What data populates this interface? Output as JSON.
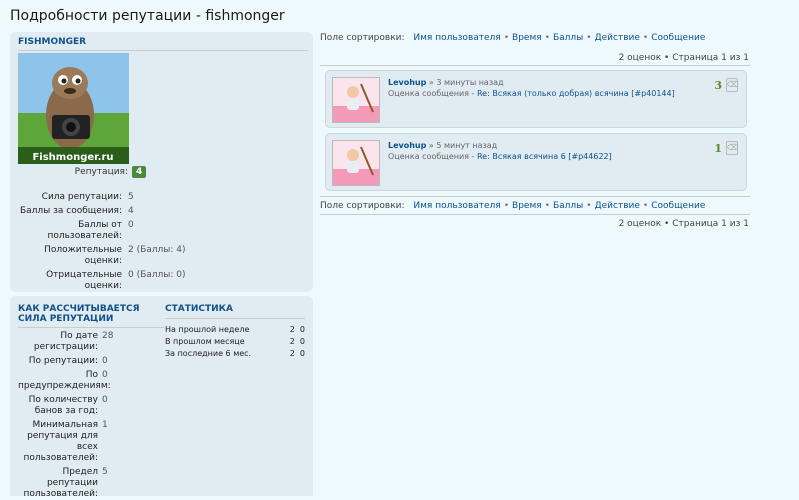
{
  "page": {
    "title": "Подробности репутации - fishmonger"
  },
  "profile": {
    "username": "FISHMONGER",
    "avatar_caption": "Fishmonger.ru",
    "reputation_label": "Репутация:",
    "reputation_value": "4",
    "stats": [
      {
        "label": "Сила репутации:",
        "value": "5"
      },
      {
        "label": "Баллы за сообщения:",
        "value": "4"
      },
      {
        "label": "Баллы от пользователей:",
        "value": "0"
      },
      {
        "label": "Положительные оценки:",
        "value": "2 (Баллы: 4)"
      },
      {
        "label": "Отрицательные оценки:",
        "value": "0 (Баллы: 0)"
      }
    ]
  },
  "calc": {
    "heading": "КАК РАССЧИТЫВАЕТСЯ СИЛА РЕПУТАЦИИ",
    "rows": [
      {
        "label": "По дате регистрации:",
        "value": "28"
      },
      {
        "label": "По репутации:",
        "value": "0"
      },
      {
        "label": "По предупреждениям:",
        "value": "0"
      },
      {
        "label": "По количеству банов за год:",
        "value": "0"
      },
      {
        "label": "Минимальная репутация для всех пользователей:",
        "value": "1"
      },
      {
        "label": "Предел репутации пользователей:",
        "value": "5"
      }
    ]
  },
  "statistics": {
    "heading": "СТАТИСТИКА",
    "rows": [
      {
        "label": "На прошлой неделе",
        "a": "2",
        "b": "0"
      },
      {
        "label": "В прошлом месяце",
        "a": "2",
        "b": "0"
      },
      {
        "label": "За последние 6 мес.",
        "a": "2",
        "b": "0"
      }
    ]
  },
  "sort": {
    "label": "Поле сортировки:",
    "options": [
      "Имя пользователя",
      "Время",
      "Баллы",
      "Действие",
      "Сообщение"
    ],
    "separator": "•"
  },
  "pagination": {
    "text": "2 оценок • Страница 1 из 1"
  },
  "posts": [
    {
      "user": "Levohup",
      "time": "» 3 минуты назад",
      "prefix": "Оценка сообщения - ",
      "topic": "Re: Всякая (только добрая) всячина",
      "ref": "[#p40144]",
      "score": "3"
    },
    {
      "user": "Levohup",
      "time": "» 5 минут назад",
      "prefix": "Оценка сообщения - ",
      "topic": "Re: Всякая всячина 6",
      "ref": "[#p44622]",
      "score": "1"
    }
  ],
  "colors": {
    "accent": "#105289",
    "badge": "#4a8a3a",
    "panel": "#e1ebf2",
    "background": "#eef9fd"
  }
}
